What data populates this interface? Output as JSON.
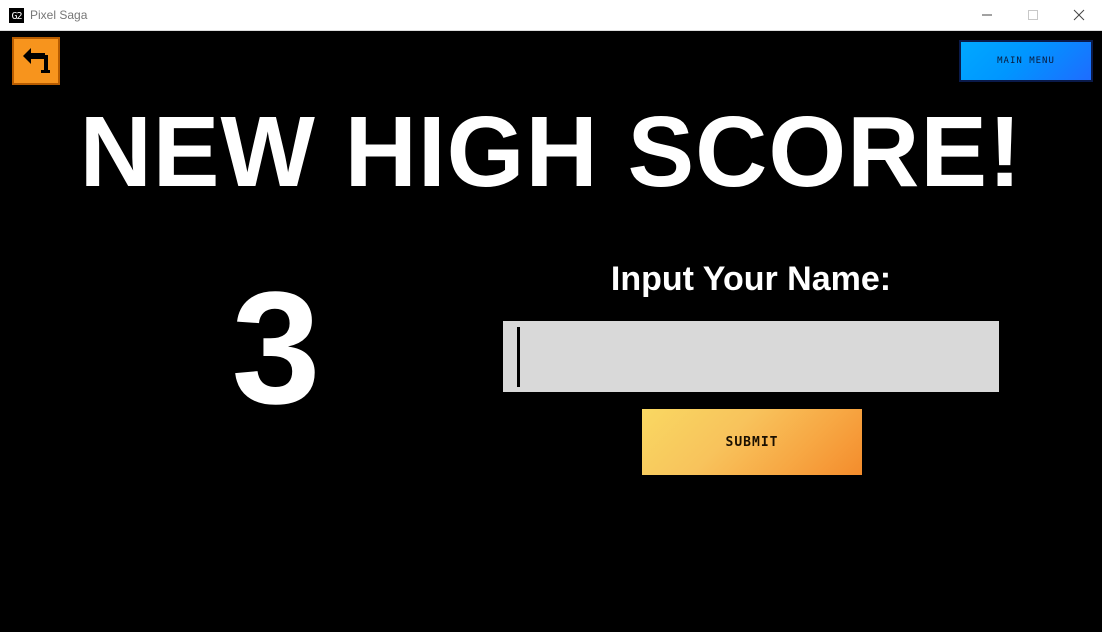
{
  "window": {
    "title": "Pixel Saga",
    "icon_text": "G2"
  },
  "header": {
    "main_menu_label": "MAIN MENU"
  },
  "main": {
    "headline": "NEW HIGH SCORE!",
    "score": "3",
    "name_label": "Input Your Name:",
    "name_value": "",
    "submit_label": "SUBMIT"
  },
  "icons": {
    "back": "back-arrow-icon",
    "minimize": "minimize-icon",
    "maximize": "maximize-icon",
    "close": "close-icon"
  },
  "colors": {
    "background": "#000000",
    "back_button": "#f7941d",
    "main_menu_button": "#00a8ff",
    "submit_button": "#f8c35c",
    "input_field": "#d9d9d9"
  }
}
